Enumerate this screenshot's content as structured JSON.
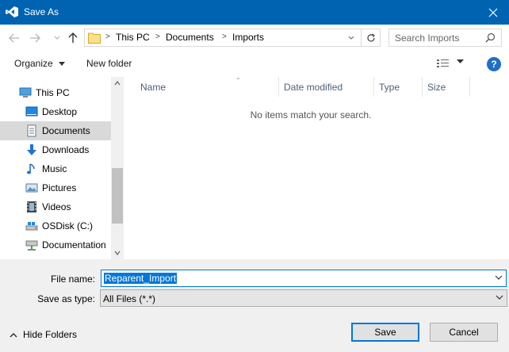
{
  "window": {
    "title": "Save As"
  },
  "address": {
    "crumbs": [
      "This PC",
      "Documents",
      "Imports"
    ]
  },
  "search": {
    "placeholder": "Search Imports"
  },
  "toolbar": {
    "organize_label": "Organize",
    "new_folder_label": "New folder",
    "help_label": "?"
  },
  "sidebar": {
    "items": [
      {
        "label": "This PC",
        "icon": "computer-icon"
      },
      {
        "label": "Desktop",
        "icon": "desktop-icon"
      },
      {
        "label": "Documents",
        "icon": "documents-icon"
      },
      {
        "label": "Downloads",
        "icon": "downloads-icon"
      },
      {
        "label": "Music",
        "icon": "music-icon"
      },
      {
        "label": "Pictures",
        "icon": "pictures-icon"
      },
      {
        "label": "Videos",
        "icon": "videos-icon"
      },
      {
        "label": "OSDisk (C:)",
        "icon": "drive-icon"
      },
      {
        "label": "Documentation",
        "icon": "network-drive-icon"
      }
    ],
    "selected": "Documents"
  },
  "list": {
    "columns": [
      "Name",
      "Date modified",
      "Type",
      "Size"
    ],
    "empty_message": "No items match your search."
  },
  "form": {
    "file_name_label": "File name:",
    "file_name_value": "Reparent_Import",
    "save_type_label": "Save as type:",
    "save_type_value": "All Files (*.*)"
  },
  "footer": {
    "hide_folders_label": "Hide Folders",
    "save_label": "Save",
    "cancel_label": "Cancel"
  },
  "colors": {
    "titlebar": "#0063b1",
    "selection": "#0078d7",
    "accent": "#1f6fc7"
  }
}
